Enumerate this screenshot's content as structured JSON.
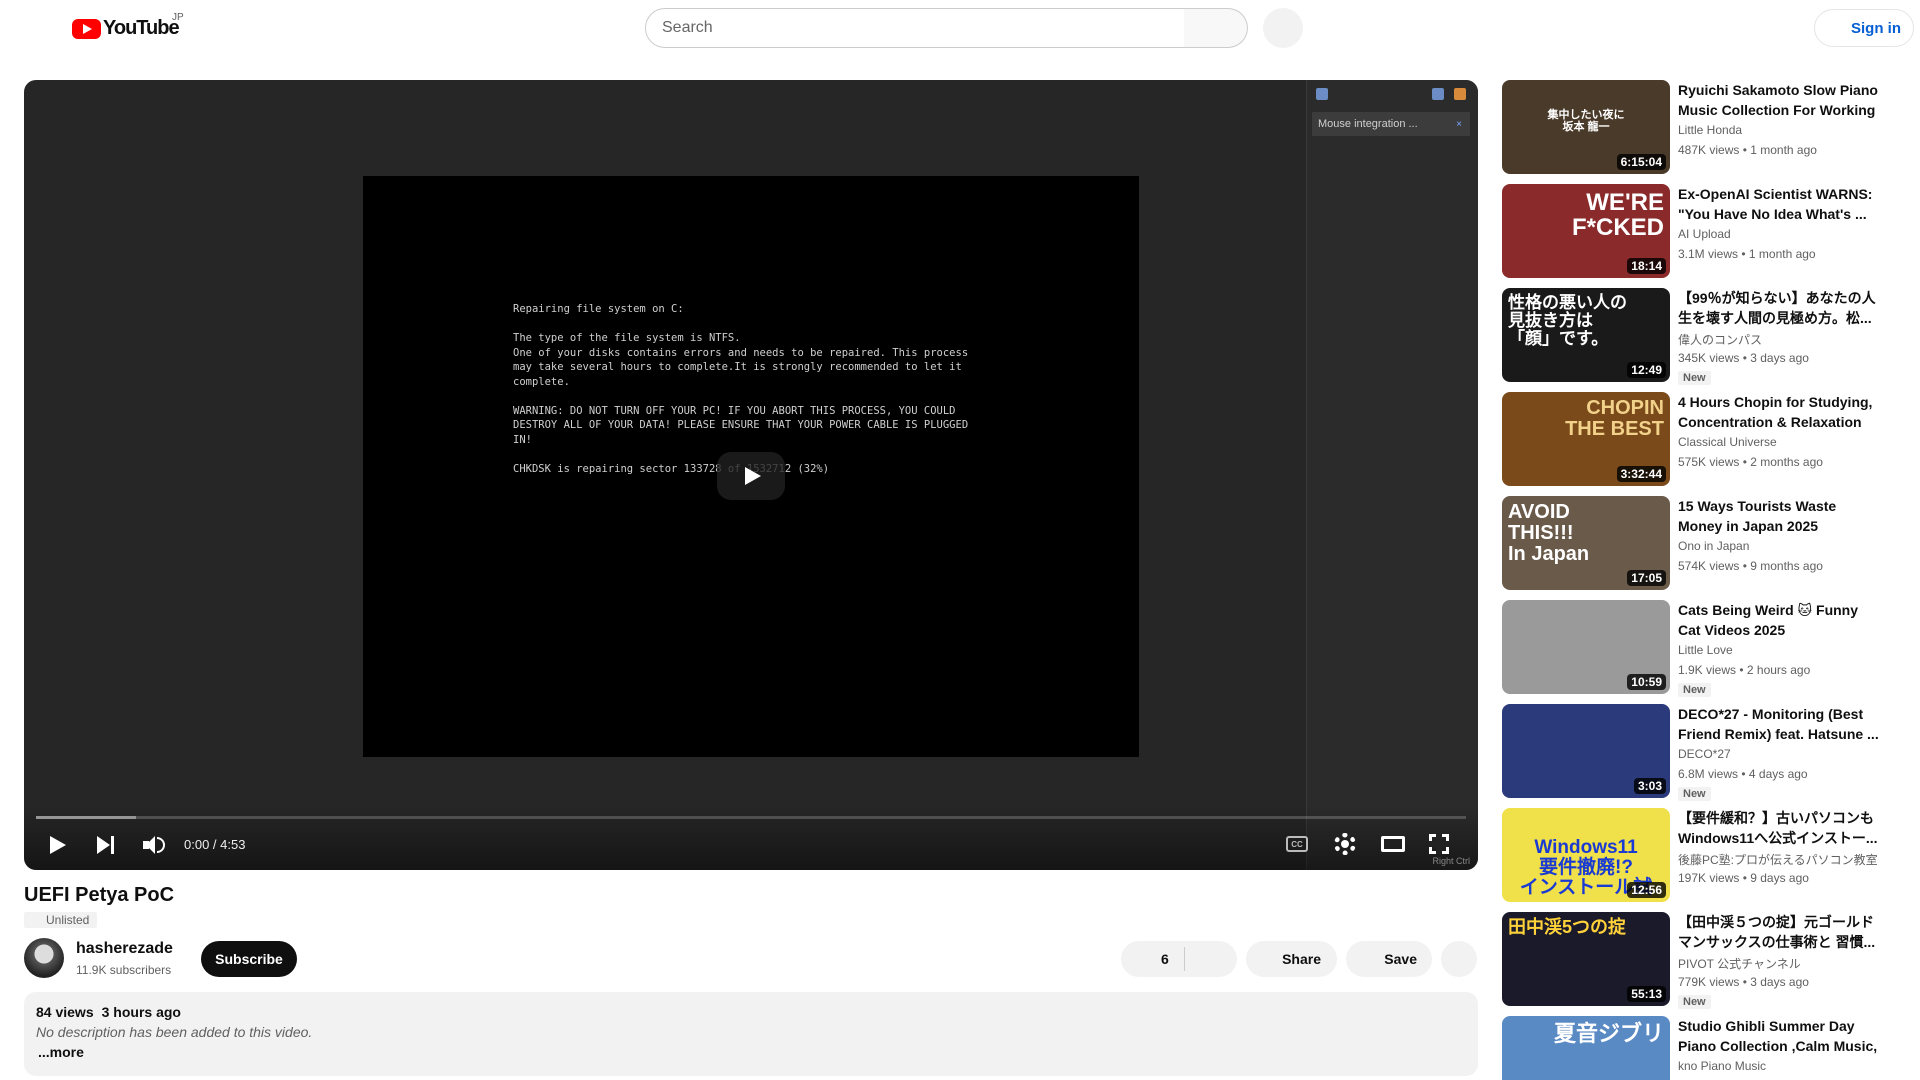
{
  "header": {
    "logo_text": "YouTube",
    "logo_country": "JP",
    "search_placeholder": "Search",
    "signin_label": "Sign in"
  },
  "player": {
    "vm_notice": "Mouse integration ...",
    "vm_notice_close": "×",
    "screen_text": "Repairing file system on C:\n\nThe type of the file system is NTFS.\nOne of your disks contains errors and needs to be repaired. This process\nmay take several hours to complete.It is strongly recommended to let it\ncomplete.\n\nWARNING: DO NOT TURN OFF YOUR PC! IF YOU ABORT THIS PROCESS, YOU COULD\nDESTROY ALL OF YOUR DATA! PLEASE ENSURE THAT YOUR POWER CABLE IS PLUGGED\nIN!\n\nCHKDSK is repairing sector 133728 of 1532712 (32%)",
    "time_display": "0:00 / 4:53",
    "cc_label": "CC",
    "buffered_fraction": 0.07,
    "vm_status": "Right Ctrl"
  },
  "video": {
    "title": "UEFI Petya PoC",
    "visibility": "Unlisted",
    "channel_name": "hasherezade",
    "subscribers": "11.9K subscribers",
    "subscribe_label": "Subscribe",
    "like_count": "6",
    "share_label": "Share",
    "save_label": "Save",
    "views": "84 views",
    "posted": "3 hours ago",
    "description": "No description has been added to this video.",
    "more_label": "...more"
  },
  "recommendations": [
    {
      "title": "Ryuichi Sakamoto Slow Piano Music Collection For Working ...",
      "channel": "Little Honda",
      "meta": "487K views • 1 month ago",
      "duration": "6:15:04",
      "badge": "",
      "thumb_text": "集中したい夜に\n坂本 龍一",
      "thumb_bg": "#4a3a2a"
    },
    {
      "title": "Ex-OpenAI Scientist WARNS: \"You Have No Idea What's ...",
      "channel": "AI Upload",
      "meta": "3.1M views • 1 month ago",
      "duration": "18:14",
      "badge": "",
      "thumb_text": "WE'RE\nF*CKED",
      "thumb_bg": "#8a2a2a"
    },
    {
      "title": "【99％が知らない】あなたの人生を壊す人間の見極め方。松...",
      "channel": "偉人のコンパス",
      "meta": "345K views • 3 days ago",
      "duration": "12:49",
      "badge": "New",
      "thumb_text": "性格の悪い人の\n見抜き方は\n「顔」です。",
      "thumb_bg": "#1a1a1a"
    },
    {
      "title": "4 Hours Chopin for Studying, Concentration & Relaxation",
      "channel": "Classical Universe",
      "meta": "575K views • 2 months ago",
      "duration": "3:32:44",
      "badge": "",
      "thumb_text": "CHOPIN\nTHE BEST",
      "thumb_bg": "#7a4a1a"
    },
    {
      "title": "15 Ways Tourists Waste Money in Japan 2025",
      "channel": "Ono in Japan",
      "meta": "574K views • 9 months ago",
      "duration": "17:05",
      "badge": "",
      "thumb_text": "AVOID\nTHIS!!!\nIn Japan",
      "thumb_bg": "#6a5a4a"
    },
    {
      "title": "Cats Being Weird 🐱 Funny Cat Videos 2025",
      "channel": "Little Love",
      "meta": "1.9K views • 2 hours ago",
      "duration": "10:59",
      "badge": "New",
      "thumb_text": "",
      "thumb_bg": "#9a9a9a"
    },
    {
      "title": "DECO*27 - Monitoring (Best Friend Remix) feat. Hatsune ...",
      "channel": "DECO*27",
      "meta": "6.8M views • 4 days ago",
      "duration": "3:03",
      "badge": "New",
      "thumb_text": "",
      "thumb_bg": "#2a3a7a"
    },
    {
      "title": "【要件緩和？】古いパソコンもWindows11へ公式インストー...",
      "channel": "後藤PC塾:プロが伝えるパソコン教室",
      "meta": "197K views • 9 days ago",
      "duration": "12:56",
      "badge": "",
      "thumb_text": "Windows11\n要件撤廃!?\nインストール試",
      "thumb_bg": "#f0e04a"
    },
    {
      "title": "【田中渓５つの掟】元ゴールドマンサックスの仕事術と 習慣...",
      "channel": "PIVOT 公式チャンネル",
      "meta": "779K views • 3 days ago",
      "duration": "55:13",
      "badge": "New",
      "thumb_text": "田中渓5つの掟",
      "thumb_bg": "#1a1a2a"
    },
    {
      "title": "Studio Ghibli Summer Day Piano Collection ,Calm Music, ...",
      "channel": "kno Piano Music",
      "meta": "",
      "duration": "",
      "badge": "",
      "thumb_text": "夏音ジブリ",
      "thumb_bg": "#5a8ac4"
    }
  ]
}
